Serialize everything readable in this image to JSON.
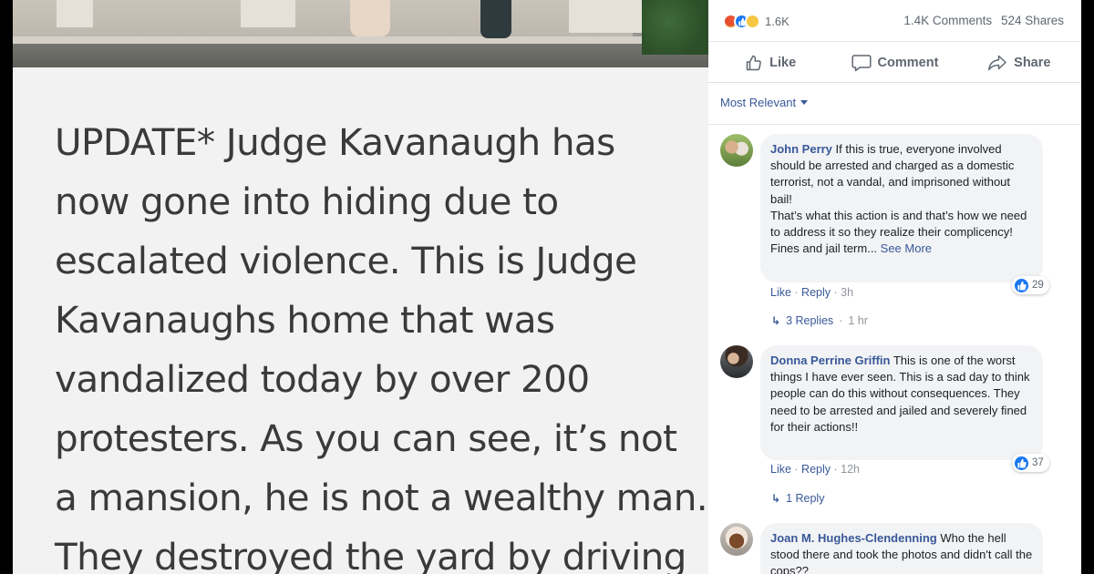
{
  "post": {
    "lines": [
      "UPDATE* Judge Kavanaugh has",
      "now gone into hiding due to",
      "escalated violence. This is Judge",
      "Kavanaughs home that was",
      "vandalized today by over 200",
      "protesters. As you can see, it’s not",
      "a mansion, he is not a wealthy man.",
      "They destroyed the yard by driving"
    ]
  },
  "stats": {
    "reactions": "1.6K",
    "comments": "1.4K Comments",
    "shares": "524 Shares"
  },
  "actions": {
    "like": "Like",
    "comment": "Comment",
    "share": "Share"
  },
  "sort": {
    "label": "Most Relevant"
  },
  "comments": [
    {
      "name": "John Perry",
      "text": " If this is true, everyone involved should be arrested and charged as a domestic terrorist, not a vandal, and imprisoned without bail!\nThat’s what this action is and that’s how we need to address it so they realize their complicency!\nFines and jail term... ",
      "see_more": "See More",
      "likes": "29",
      "like_label": "Like",
      "reply_label": "Reply",
      "time": "3h",
      "replies_label": "3 Replies",
      "replies_time": "1 hr"
    },
    {
      "name": "Donna Perrine Griffin",
      "text": " This is one of the worst things I have ever seen. This is a sad day to think people can do this without consequences. They need to be arrested and jailed and severely fined for their actions!!",
      "likes": "37",
      "like_label": "Like",
      "reply_label": "Reply",
      "time": "12h",
      "replies_label": "1 Reply"
    },
    {
      "name": "Joan M. Hughes-Clendenning",
      "text": " Who the hell stood there and took the photos and didn't call the cops??"
    }
  ],
  "colors": {
    "link": "#385898",
    "like_blue": "#1877f2",
    "meta_gray": "#90949c",
    "post_text": "#3a3a3a"
  }
}
